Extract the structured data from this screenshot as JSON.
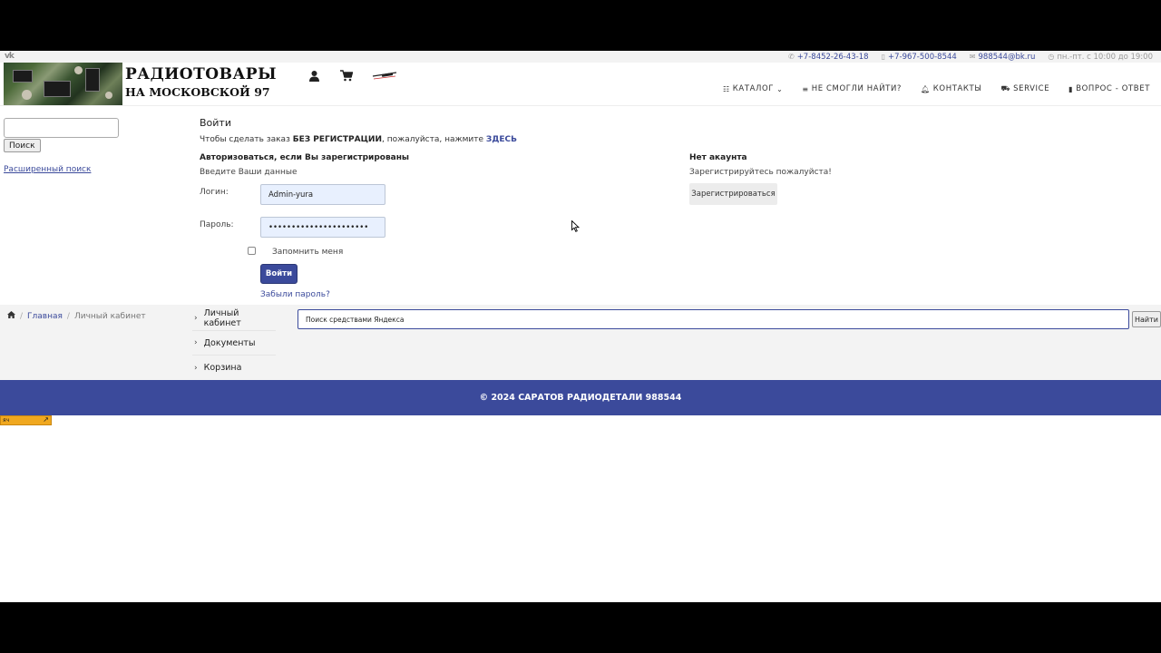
{
  "topbar": {
    "phone1": "+7-8452-26-43-18",
    "phone2": "+7-967-500-8544",
    "email": "988544@bk.ru",
    "hours": "пн.-пт. с 10:00 до 19:00"
  },
  "logo": {
    "line1": "РАДИОТОВАРЫ",
    "line2": "НА МОСКОВСКОЙ 97"
  },
  "nav": [
    {
      "icon": "list-icon",
      "label": "КАТАЛОГ"
    },
    {
      "icon": "bars-icon",
      "label": "НЕ СМОГЛИ НАЙТИ?"
    },
    {
      "icon": "bell-icon",
      "label": "КОНТАКТЫ"
    },
    {
      "icon": "truck-icon",
      "label": "SERVICE"
    },
    {
      "icon": "bookmark-icon",
      "label": "ВОПРОС - ОТВЕТ"
    }
  ],
  "sidebar": {
    "search_value": "",
    "search_button": "Поиск",
    "advanced_link": "Расширенный поиск"
  },
  "login": {
    "title": "Войти",
    "note_prefix": "Чтобы сделать заказ",
    "note_bold": "БЕЗ РЕГИСТРАЦИИ",
    "note_mid": ", пожалуйста, нажмите",
    "note_link": "ЗДЕСЬ",
    "auth_heading": "Авторизоваться, если Вы зарегистрированы",
    "auth_sub": "Введите Ваши данные",
    "login_label": "Логин:",
    "login_value": "Admin-yura",
    "password_label": "Пароль:",
    "password_value": "••••••••••••••••••••••",
    "remember_label": "Запомнить меня",
    "submit_label": "Войти",
    "forgot_link": "Забыли пароль?"
  },
  "register": {
    "heading": "Нет акаунта",
    "sub": "Зарегистрируйтесь пожалуйста!",
    "button": "Зарегистрироваться"
  },
  "breadcrumb": {
    "home": "Главная",
    "current": "Личный кабинет"
  },
  "subnav": [
    "Личный кабинет",
    "Документы",
    "Корзина"
  ],
  "yandex_search": {
    "value": "Поиск средствами Яндекса",
    "button": "Найти"
  },
  "footer": {
    "copyright": "© 2024 САРАТОВ РАДИОДЕТАЛИ 988544"
  },
  "counter": {
    "label": "яч"
  },
  "colors": {
    "brand": "#3b4a9b",
    "band": "#f3f3f3",
    "counter": "#f0a81f"
  }
}
